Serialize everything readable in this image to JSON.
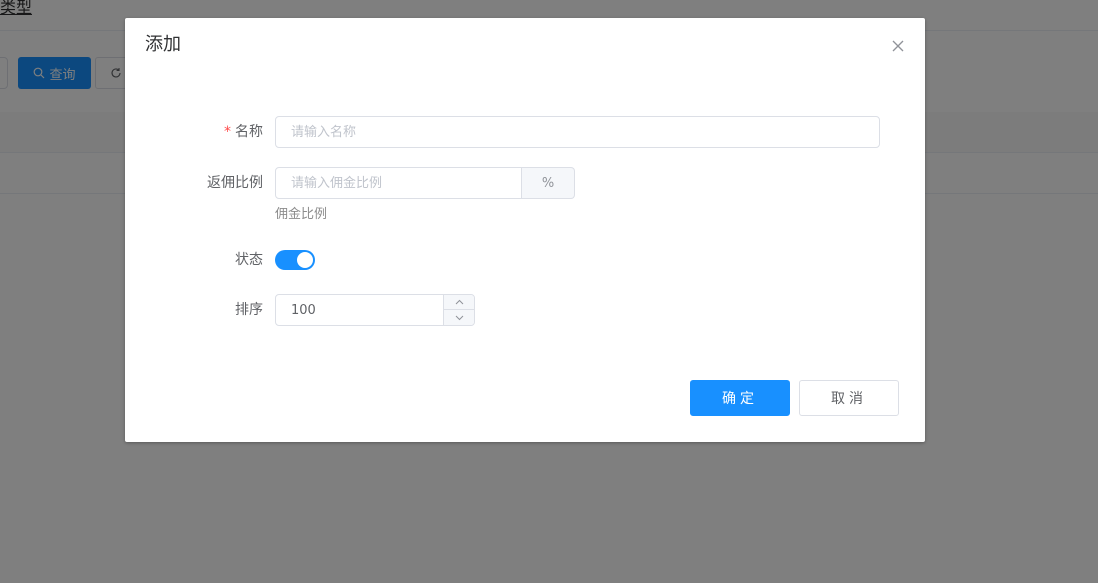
{
  "background": {
    "breadcrumb_fragment": "类型",
    "query_button": "查询",
    "search_icon": "search-icon",
    "refresh_icon": "refresh-icon"
  },
  "dialog": {
    "title": "添加",
    "close_icon": "close-icon",
    "form": {
      "name": {
        "required_mark": "*",
        "label": "名称",
        "value": "",
        "placeholder": "请输入名称"
      },
      "commission": {
        "label": "返佣比例",
        "value": "",
        "placeholder": "请输入佣金比例",
        "suffix": "%",
        "help": "佣金比例"
      },
      "status": {
        "label": "状态",
        "on": true
      },
      "sort": {
        "label": "排序",
        "value": "100"
      }
    },
    "buttons": {
      "confirm": "确定",
      "cancel": "取消"
    }
  },
  "colors": {
    "primary": "#1890ff",
    "required": "#ff4949",
    "overlay": "rgba(0,0,0,0.5)"
  }
}
